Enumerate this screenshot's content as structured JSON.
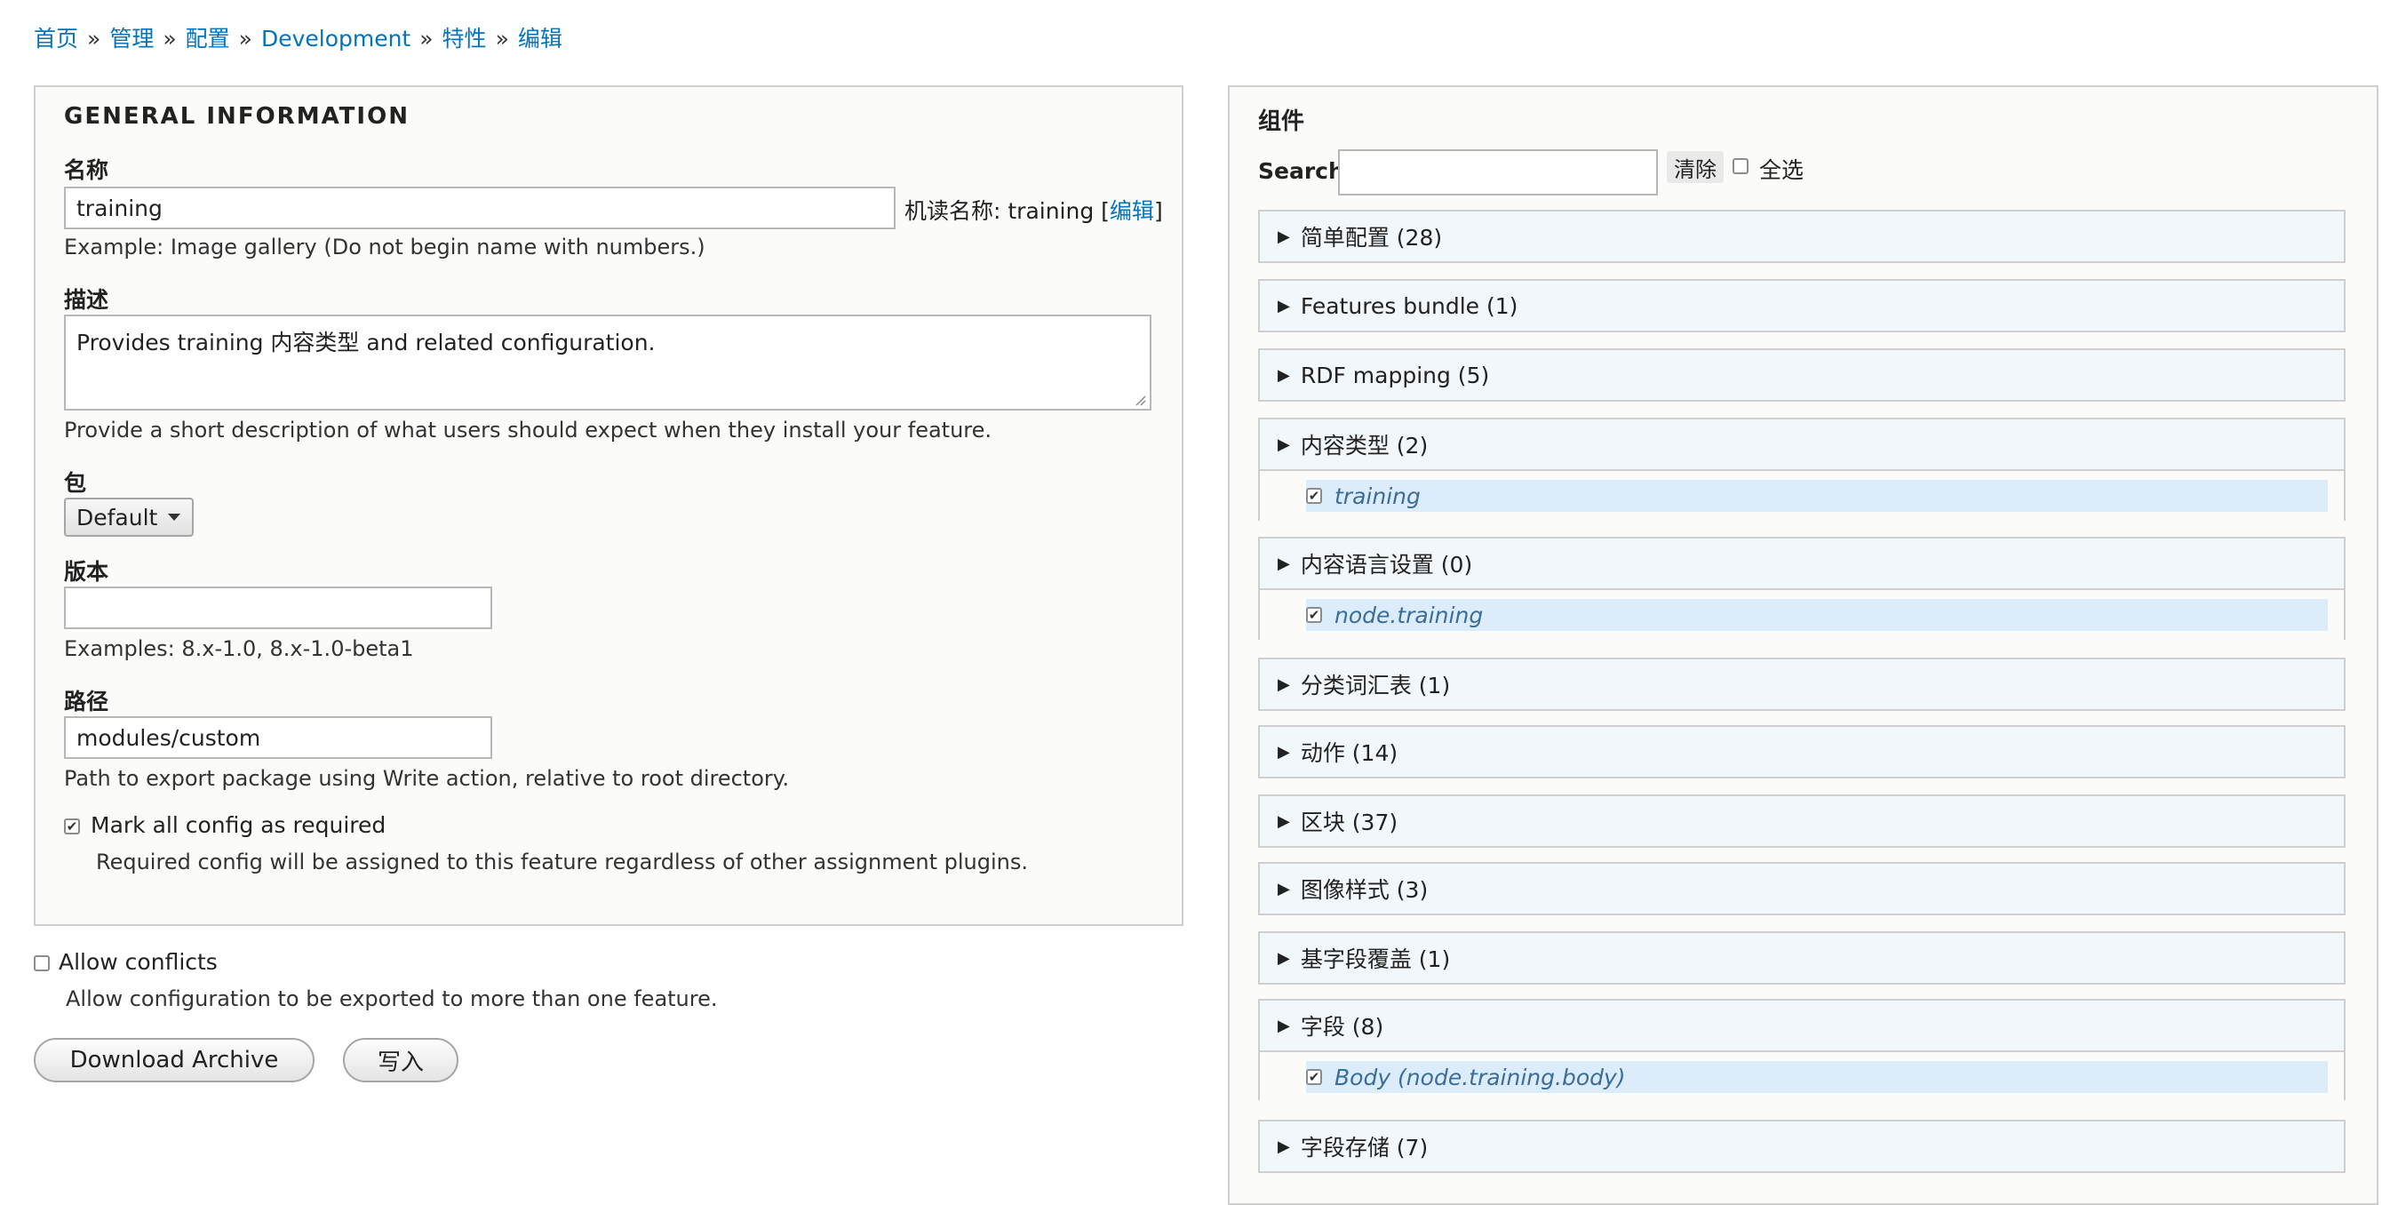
{
  "breadcrumb": {
    "items": [
      "首页",
      "管理",
      "配置",
      "Development",
      "特性",
      "编辑"
    ],
    "separator": "»"
  },
  "general": {
    "legend": "GENERAL INFORMATION",
    "name": {
      "label": "名称",
      "value": "training",
      "machine_prefix": "机读名称: training [",
      "machine_edit": "编辑",
      "machine_suffix": "]",
      "help": "Example: Image gallery (Do not begin name with numbers.)"
    },
    "description": {
      "label": "描述",
      "value": "Provides training 内容类型 and related configuration.",
      "help": "Provide a short description of what users should expect when they install your feature."
    },
    "package": {
      "label": "包",
      "selected": "Default"
    },
    "version": {
      "label": "版本",
      "value": "",
      "help": "Examples: 8.x-1.0, 8.x-1.0-beta1"
    },
    "path": {
      "label": "路径",
      "value": "modules/custom",
      "help": "Path to export package using Write action, relative to root directory."
    },
    "required": {
      "label": "Mark all config as required",
      "checked": true,
      "help": "Required config will be assigned to this feature regardless of other assignment plugins."
    }
  },
  "conflicts": {
    "label": "Allow conflicts",
    "checked": false,
    "help": "Allow configuration to be exported to more than one feature."
  },
  "actions": {
    "download": "Download Archive",
    "write": "写入"
  },
  "components": {
    "title": "组件",
    "search_label": "Search",
    "search_value": "",
    "clear_label": "清除",
    "select_all_label": "全选",
    "groups": [
      {
        "label": "简单配置 (28)"
      },
      {
        "label": "Features bundle (1)"
      },
      {
        "label": "RDF mapping (5)"
      },
      {
        "label": "内容类型 (2)",
        "item": "training"
      },
      {
        "label": "内容语言设置 (0)",
        "item": "node.training"
      },
      {
        "label": "分类词汇表 (1)"
      },
      {
        "label": "动作 (14)"
      },
      {
        "label": "区块 (37)"
      },
      {
        "label": "图像样式 (3)"
      },
      {
        "label": "基字段覆盖 (1)"
      },
      {
        "label": "字段 (8)",
        "item": "Body (node.training.body)"
      },
      {
        "label": "字段存储 (7)"
      }
    ]
  },
  "colors": {
    "link": "#0074bd",
    "selected_row": "#dcecfb",
    "group_bg": "#f2f7fb"
  }
}
